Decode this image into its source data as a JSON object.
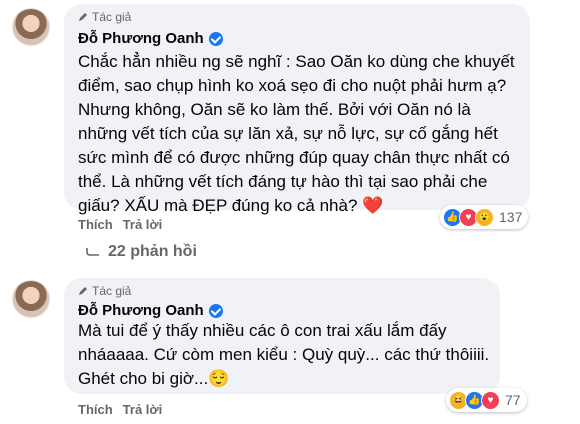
{
  "comments": [
    {
      "author_tag": "Tác giả",
      "author_name": "Đỗ Phương Oanh",
      "lines": [
        "Chắc hẳn nhiều ng sẽ nghĩ : Sao Oăn ko dùng che khuyết",
        "điểm, sao chụp hình ko xoá sẹo đi cho nuột phải hưm ạ?",
        "Nhưng không, Oăn sẽ ko làm thế. Bởi với Oăn nó là",
        "những vết tích của sự lăn xả, sự nỗ lực, sự cố gắng hết",
        "sức mình để có được những đúp quay chân thực nhất có",
        "thể. Là những vết tích đáng tự hào thì tại sao phải che",
        "giấu? XẤU mà ĐẸP đúng ko cả nhà? ❤️"
      ],
      "like_label": "Thích",
      "reply_label": "Trả lời",
      "reaction_count": "137",
      "reactions": [
        "like",
        "heart",
        "wow"
      ],
      "replies_label": "22 phản hồi"
    },
    {
      "author_tag": "Tác giả",
      "author_name": "Đỗ Phương Oanh",
      "lines": [
        "Mà tui để ý thấy nhiều các ô con trai xấu lắm đấy",
        "nháaaaa. Cứ còm men kiểu : Quỳ quỳ... các thứ thôiiii.",
        "Ghét cho bi giờ...😌"
      ],
      "like_label": "Thích",
      "reply_label": "Trả lời",
      "reaction_count": "77",
      "reactions": [
        "haha",
        "like",
        "heart"
      ]
    }
  ],
  "colors": {
    "like": "#1877f2",
    "heart": "#f33e58",
    "haha": "#f7b125",
    "secondary_text": "#65676b",
    "bubble": "#f0f2f5"
  },
  "icons": {
    "author_tag_icon": "pencil-icon",
    "replies_icon": "reply-arrow-icon"
  }
}
